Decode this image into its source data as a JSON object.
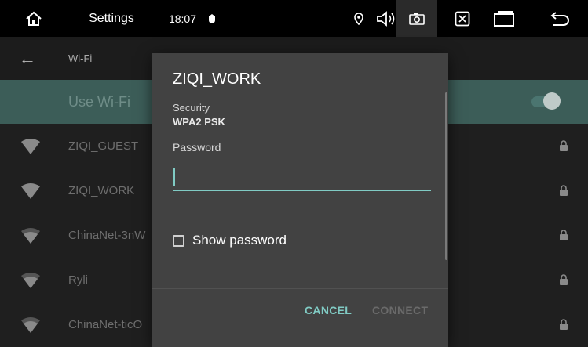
{
  "status_bar": {
    "home_icon": "home-icon",
    "title": "Settings",
    "time": "18:07",
    "icons": [
      "notification-dot-icon",
      "location-icon",
      "volume-icon",
      "screenshot-icon",
      "close-box-icon",
      "recent-apps-icon",
      "back-icon"
    ]
  },
  "app_bar": {
    "back_icon": "arrow-left-icon",
    "title": "Wi-Fi"
  },
  "use_wifi": {
    "label": "Use Wi-Fi",
    "enabled": true
  },
  "networks": [
    {
      "name": "ZIQI_GUEST",
      "signal_level": 4,
      "locked": true
    },
    {
      "name": "ZIQI_WORK",
      "signal_level": 4,
      "locked": true
    },
    {
      "name": "ChinaNet-3nW",
      "signal_level": 3,
      "locked": true
    },
    {
      "name": "Ryli",
      "signal_level": 3,
      "locked": true
    },
    {
      "name": "ChinaNet-ticO",
      "signal_level": 3,
      "locked": true
    }
  ],
  "dialog": {
    "title": "ZIQI_WORK",
    "security_label": "Security",
    "security_value": "WPA2 PSK",
    "password_label": "Password",
    "password_value": "",
    "show_password_label": "Show password",
    "show_password_checked": false,
    "cancel_label": "CANCEL",
    "connect_label": "CONNECT"
  },
  "colors": {
    "accent": "#80cbc4",
    "dialog_bg": "#424242",
    "bar_bg": "#000000",
    "wifi_row_bg": "#3c5d58"
  }
}
